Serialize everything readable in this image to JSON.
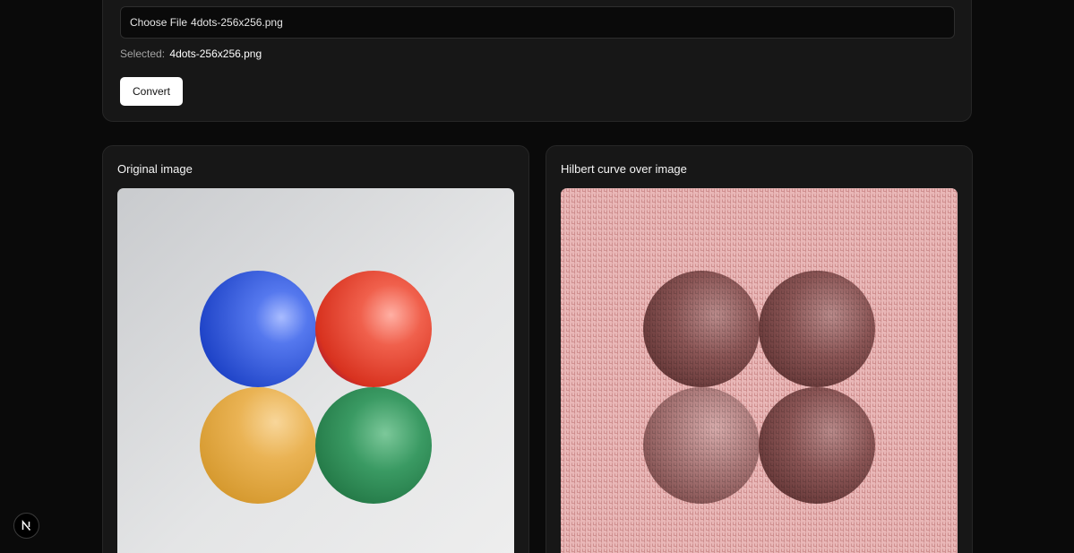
{
  "upload": {
    "file_button_label": "Choose File",
    "file_name": "4dots-256x256.png",
    "selected_label": "Selected:",
    "selected_file": "4dots-256x256.png",
    "convert_label": "Convert"
  },
  "panels": [
    {
      "title": "Original image"
    },
    {
      "title": "Hilbert curve over image"
    }
  ],
  "colors": {
    "page_background": "#0a0a0a",
    "card_background": "#171717",
    "ball_blue": "#2f5fe0",
    "ball_red": "#e8493a",
    "ball_yellow": "#e3a83c",
    "ball_green": "#2e8a55",
    "overlay_pink": "#e8b0b0",
    "overlay_ball": "#7a4646"
  },
  "icons": {
    "nextjs_badge": "n-logo-icon"
  }
}
